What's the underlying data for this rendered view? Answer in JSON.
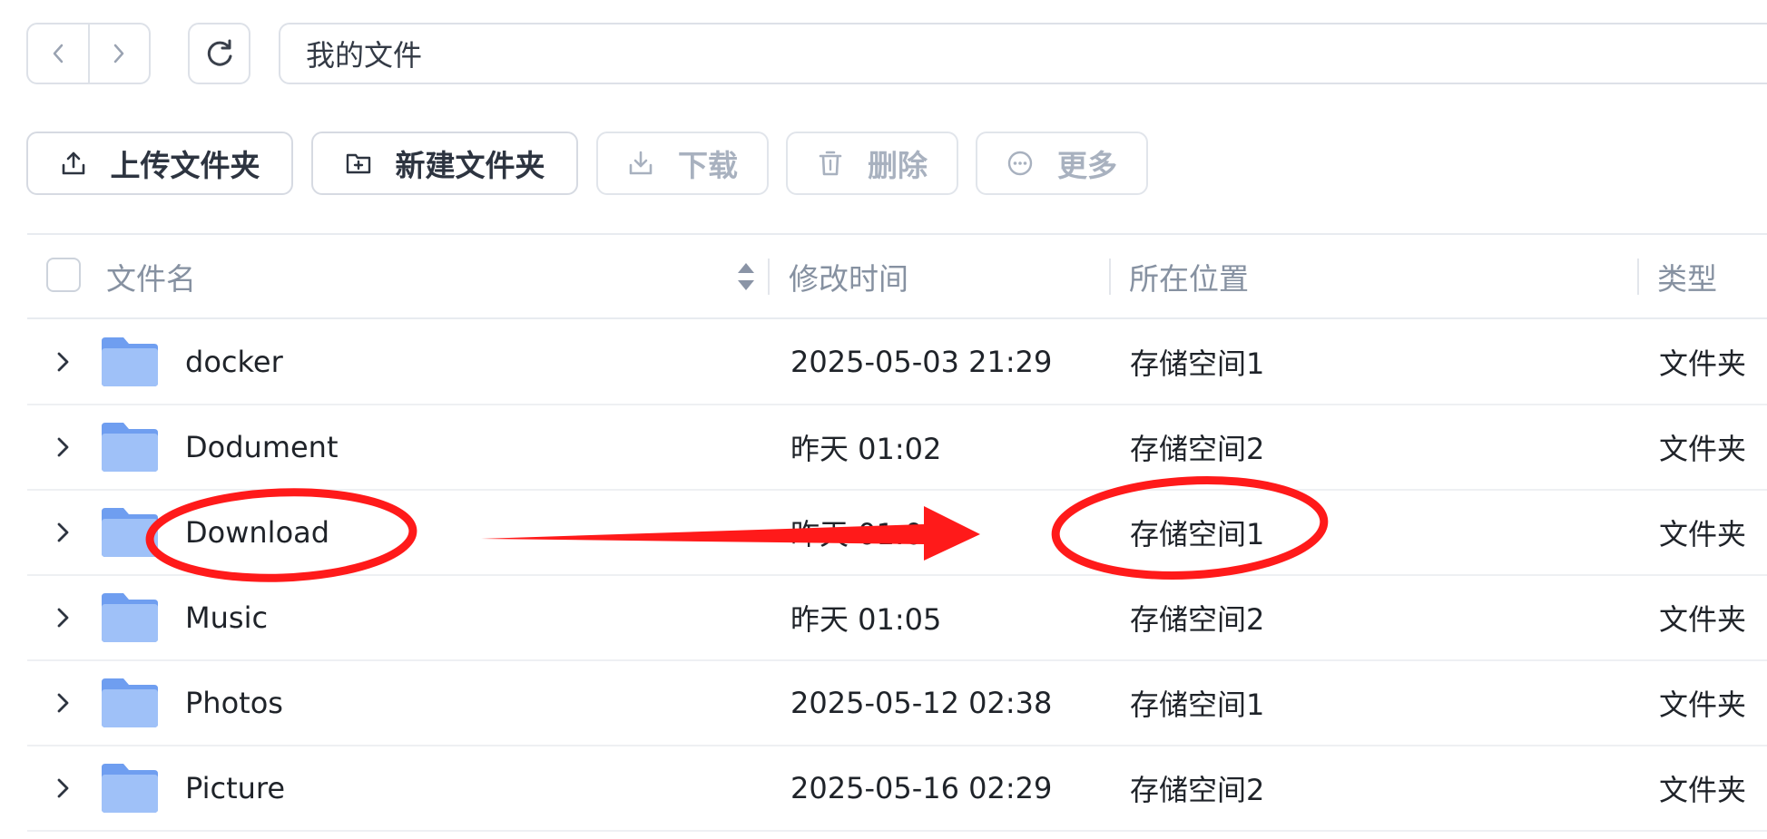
{
  "nav": {
    "back_icon": "chevron-left-icon",
    "forward_icon": "chevron-right-icon",
    "refresh_icon": "refresh-icon",
    "path": "我的文件"
  },
  "toolbar": {
    "upload_folder": "上传文件夹",
    "new_folder": "新建文件夹",
    "download": "下载",
    "delete": "删除",
    "more": "更多"
  },
  "table": {
    "columns": {
      "name": "文件名",
      "modified": "修改时间",
      "location": "所在位置",
      "type": "类型"
    },
    "rows": [
      {
        "name": "docker",
        "modified": "2025-05-03 21:29",
        "location": "存储空间1",
        "type": "文件夹"
      },
      {
        "name": "Dodument",
        "modified": "昨天 01:02",
        "location": "存储空间2",
        "type": "文件夹"
      },
      {
        "name": "Download",
        "modified": "昨天 01:03",
        "location": "存储空间1",
        "type": "文件夹"
      },
      {
        "name": "Music",
        "modified": "昨天 01:05",
        "location": "存储空间2",
        "type": "文件夹"
      },
      {
        "name": "Photos",
        "modified": "2025-05-12 02:38",
        "location": "存储空间1",
        "type": "文件夹"
      },
      {
        "name": "Picture",
        "modified": "2025-05-16 02:29",
        "location": "存储空间2",
        "type": "文件夹"
      }
    ]
  },
  "colors": {
    "border": "#dde1e8",
    "folder": "#6f9ef0",
    "folder_front": "#9fc1f8",
    "annotation": "#ff1a1a",
    "disabled_text": "#a8b1bf"
  }
}
